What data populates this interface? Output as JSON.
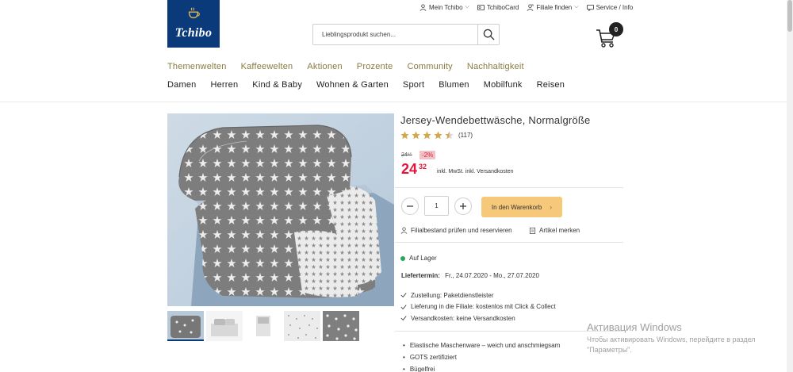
{
  "brand": {
    "logo_text": "Tchibo",
    "color": "#0a3a7a"
  },
  "utility_nav": [
    {
      "label": "Mein Tchibo",
      "icon": "user-icon",
      "has_dropdown": true
    },
    {
      "label": "TchiboCard",
      "icon": "card-icon",
      "has_dropdown": false
    },
    {
      "label": "Filiale finden",
      "icon": "store-person-icon",
      "has_dropdown": true
    },
    {
      "label": "Service / Info",
      "icon": "chat-icon",
      "has_dropdown": false
    }
  ],
  "search": {
    "placeholder": "Lieblingsprodukt suchen..."
  },
  "cart": {
    "count": "0"
  },
  "nav_primary": [
    "Themenwelten",
    "Kaffeewelten",
    "Aktionen",
    "Prozente",
    "Community",
    "Nachhaltigkeit"
  ],
  "nav_secondary": [
    "Damen",
    "Herren",
    "Kind & Baby",
    "Wohnen & Garten",
    "Sport",
    "Blumen",
    "Mobilfunk",
    "Reisen"
  ],
  "product": {
    "title": "Jersey-Wendebettwäsche, Normalgröße",
    "rating": 4.5,
    "rating_count": "(117)",
    "old_price": "24⁹⁵",
    "discount": "-2%",
    "price_main": "24",
    "price_cents": "32",
    "vat_note": "inkl. MwSt. inkl. Versandkosten",
    "quantity": "1",
    "add_to_cart": "In den Warenkorb",
    "store_check": "Filialbestand prüfen und reservieren",
    "remember": "Artikel merken",
    "stock": "Auf Lager",
    "delivery_label": "Liefertermin:",
    "delivery_value": "Fr., 24.07.2020 - Mo., 27.07.2020",
    "shipping_features": [
      "Zustellung: Paketdienstleister",
      "Lieferung in die Filiale: kostenlos mit Click & Collect",
      "Versandkosten: keine Versandkosten"
    ],
    "bullets": [
      "Elastische Maschenware – weich und anschmiegsam",
      "GOTS zertifiziert",
      "Bügelfrei"
    ],
    "thumbnail_count": 5
  },
  "colors": {
    "accent_gold": "#8a7a3f",
    "price_red": "#e4153a",
    "cart_button": "#f6c879",
    "in_stock": "#2aa55a"
  },
  "windows_watermark": {
    "title": "Активация Windows",
    "line1": "Чтобы активировать Windows, перейдите в раздел",
    "line2": "\"Параметры\"."
  }
}
